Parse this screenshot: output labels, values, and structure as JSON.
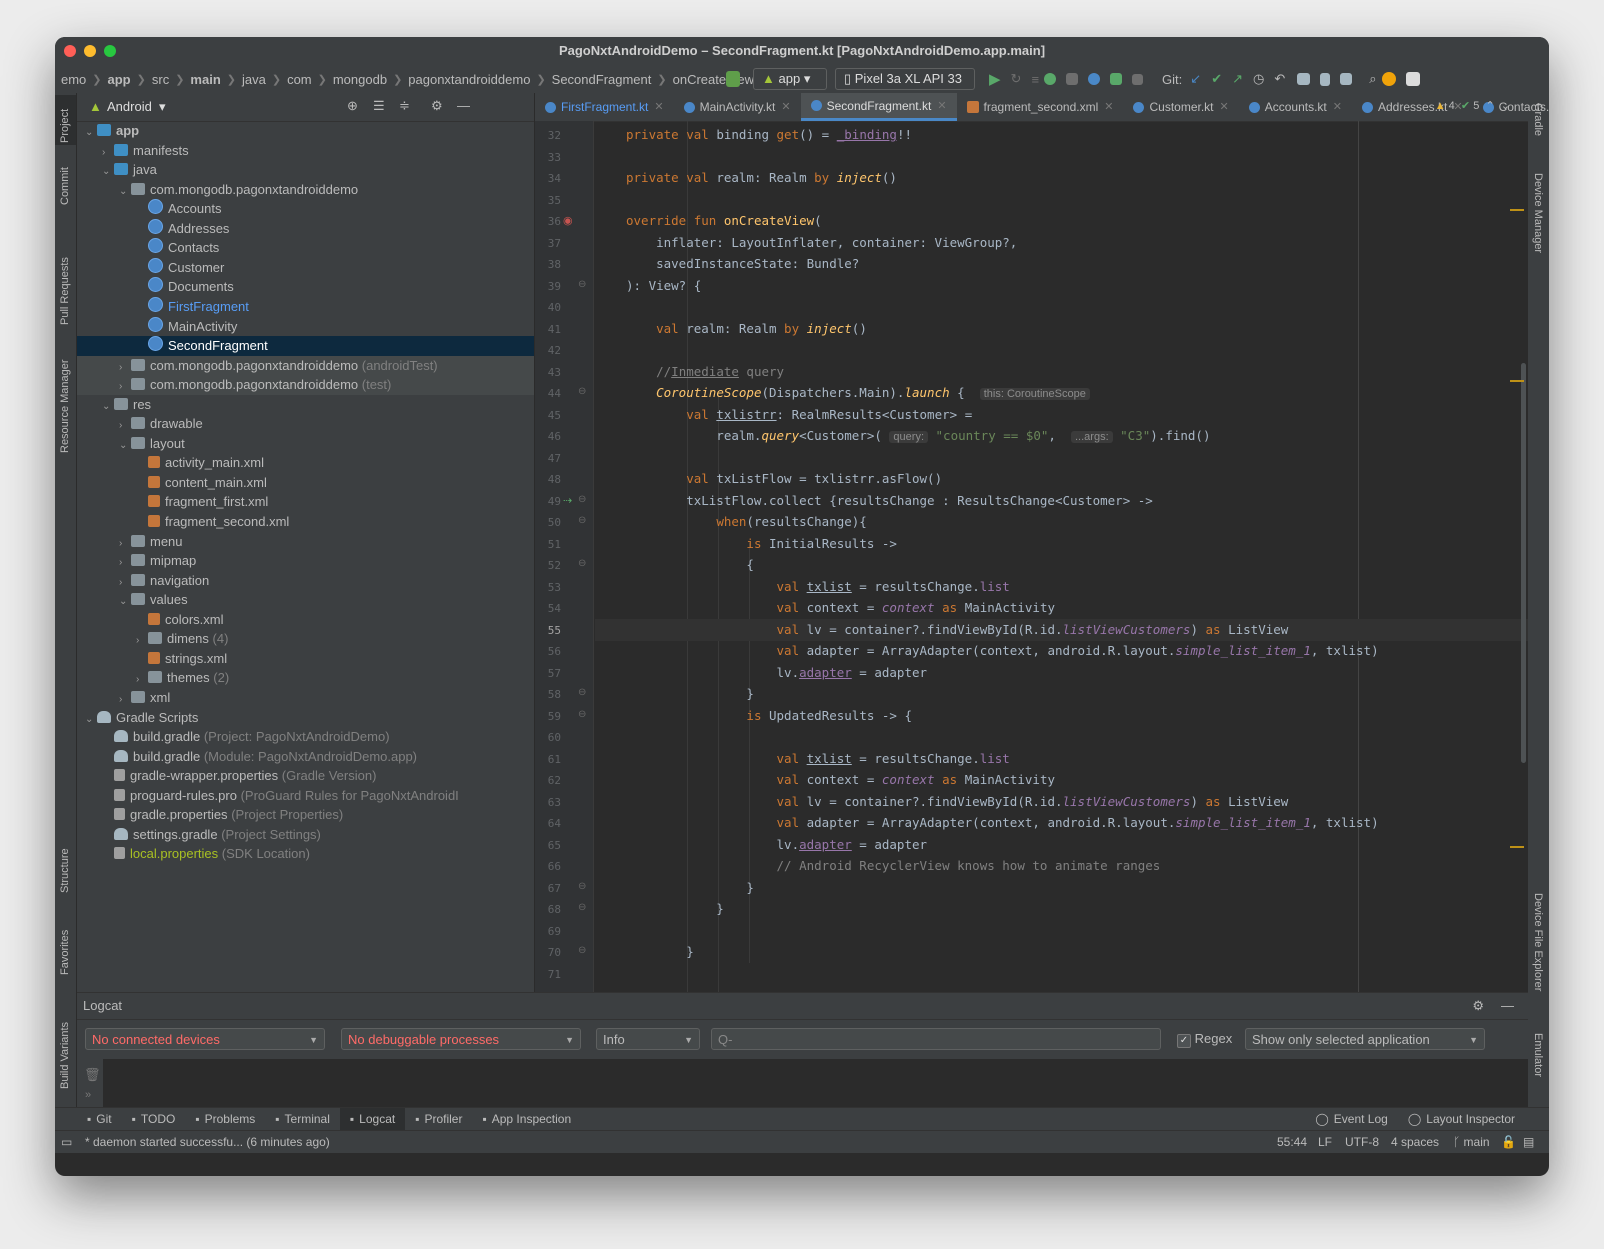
{
  "window": {
    "title": "PagoNxtAndroidDemo – SecondFragment.kt [PagoNxtAndroidDemo.app.main]"
  },
  "breadcrumbs": [
    "emo",
    "app",
    "src",
    "main",
    "java",
    "com",
    "mongodb",
    "pagonxtandroiddemo",
    "SecondFragment",
    "onCreateView"
  ],
  "toolbar": {
    "config": "app",
    "device": "Pixel 3a XL API 33",
    "git_label": "Git:"
  },
  "left_tool_windows": [
    "Project",
    "Commit",
    "Pull Requests",
    "Resource Manager",
    "Structure",
    "Favorites",
    "Build Variants"
  ],
  "right_tool_windows": [
    "Gradle",
    "Device Manager",
    "Device File Explorer",
    "Emulator"
  ],
  "project_panel": {
    "view": "Android",
    "tree": [
      {
        "label": "app",
        "hint": "",
        "depth": 0,
        "chev": "v",
        "icon": "folder-blue",
        "bold": true
      },
      {
        "label": "manifests",
        "hint": "",
        "depth": 1,
        "chev": ">",
        "icon": "folder-blue"
      },
      {
        "label": "java",
        "hint": "",
        "depth": 1,
        "chev": "v",
        "icon": "folder-blue"
      },
      {
        "label": "com.mongodb.pagonxtandroiddemo",
        "hint": "",
        "depth": 2,
        "chev": "v",
        "icon": "package"
      },
      {
        "label": "Accounts",
        "hint": "",
        "depth": 3,
        "chev": "",
        "icon": "kotlin"
      },
      {
        "label": "Addresses",
        "hint": "",
        "depth": 3,
        "chev": "",
        "icon": "kotlin"
      },
      {
        "label": "Contacts",
        "hint": "",
        "depth": 3,
        "chev": "",
        "icon": "kotlin"
      },
      {
        "label": "Customer",
        "hint": "",
        "depth": 3,
        "chev": "",
        "icon": "kotlin"
      },
      {
        "label": "Documents",
        "hint": "",
        "depth": 3,
        "chev": "",
        "icon": "kotlin"
      },
      {
        "label": "FirstFragment",
        "hint": "",
        "depth": 3,
        "chev": "",
        "icon": "kotlin",
        "color": "#589df6"
      },
      {
        "label": "MainActivity",
        "hint": "",
        "depth": 3,
        "chev": "",
        "icon": "kotlin"
      },
      {
        "label": "SecondFragment",
        "hint": "",
        "depth": 3,
        "chev": "",
        "icon": "kotlin",
        "selected": true
      },
      {
        "label": "com.mongodb.pagonxtandroiddemo",
        "hint": "(androidTest)",
        "depth": 2,
        "chev": ">",
        "icon": "package",
        "highlight": true
      },
      {
        "label": "com.mongodb.pagonxtandroiddemo",
        "hint": "(test)",
        "depth": 2,
        "chev": ">",
        "icon": "package",
        "highlight": true
      },
      {
        "label": "res",
        "hint": "",
        "depth": 1,
        "chev": "v",
        "icon": "folder"
      },
      {
        "label": "drawable",
        "hint": "",
        "depth": 2,
        "chev": ">",
        "icon": "folder"
      },
      {
        "label": "layout",
        "hint": "",
        "depth": 2,
        "chev": "v",
        "icon": "folder"
      },
      {
        "label": "activity_main.xml",
        "hint": "",
        "depth": 3,
        "chev": "",
        "icon": "xml"
      },
      {
        "label": "content_main.xml",
        "hint": "",
        "depth": 3,
        "chev": "",
        "icon": "xml"
      },
      {
        "label": "fragment_first.xml",
        "hint": "",
        "depth": 3,
        "chev": "",
        "icon": "xml"
      },
      {
        "label": "fragment_second.xml",
        "hint": "",
        "depth": 3,
        "chev": "",
        "icon": "xml"
      },
      {
        "label": "menu",
        "hint": "",
        "depth": 2,
        "chev": ">",
        "icon": "folder"
      },
      {
        "label": "mipmap",
        "hint": "",
        "depth": 2,
        "chev": ">",
        "icon": "folder"
      },
      {
        "label": "navigation",
        "hint": "",
        "depth": 2,
        "chev": ">",
        "icon": "folder"
      },
      {
        "label": "values",
        "hint": "",
        "depth": 2,
        "chev": "v",
        "icon": "folder"
      },
      {
        "label": "colors.xml",
        "hint": "",
        "depth": 3,
        "chev": "",
        "icon": "xml"
      },
      {
        "label": "dimens",
        "hint": "(4)",
        "depth": 3,
        "chev": ">",
        "icon": "folder"
      },
      {
        "label": "strings.xml",
        "hint": "",
        "depth": 3,
        "chev": "",
        "icon": "xml"
      },
      {
        "label": "themes",
        "hint": "(2)",
        "depth": 3,
        "chev": ">",
        "icon": "folder"
      },
      {
        "label": "xml",
        "hint": "",
        "depth": 2,
        "chev": ">",
        "icon": "folder"
      },
      {
        "label": "Gradle Scripts",
        "hint": "",
        "depth": 0,
        "chev": "v",
        "icon": "gradle"
      },
      {
        "label": "build.gradle",
        "hint": "(Project: PagoNxtAndroidDemo)",
        "depth": 1,
        "chev": "",
        "icon": "gradle"
      },
      {
        "label": "build.gradle",
        "hint": "(Module: PagoNxtAndroidDemo.app)",
        "depth": 1,
        "chev": "",
        "icon": "gradle"
      },
      {
        "label": "gradle-wrapper.properties",
        "hint": "(Gradle Version)",
        "depth": 1,
        "chev": "",
        "icon": "prop"
      },
      {
        "label": "proguard-rules.pro",
        "hint": "(ProGuard Rules for PagoNxtAndroidI",
        "depth": 1,
        "chev": "",
        "icon": "prop"
      },
      {
        "label": "gradle.properties",
        "hint": "(Project Properties)",
        "depth": 1,
        "chev": "",
        "icon": "prop"
      },
      {
        "label": "settings.gradle",
        "hint": "(Project Settings)",
        "depth": 1,
        "chev": "",
        "icon": "gradle"
      },
      {
        "label": "local.properties",
        "hint": "(SDK Location)",
        "depth": 1,
        "chev": "",
        "icon": "prop",
        "color": "#a8c023"
      }
    ]
  },
  "editor_tabs": [
    {
      "label": "FirstFragment.kt",
      "active": false,
      "color": "#589df6"
    },
    {
      "label": "MainActivity.kt",
      "active": false
    },
    {
      "label": "SecondFragment.kt",
      "active": true
    },
    {
      "label": "fragment_second.xml",
      "active": false
    },
    {
      "label": "Customer.kt",
      "active": false
    },
    {
      "label": "Accounts.kt",
      "active": false
    },
    {
      "label": "Addresses.kt",
      "active": false
    },
    {
      "label": "Contacts.kt",
      "active": false
    }
  ],
  "inspections": {
    "warnings": "4",
    "weak_warnings": "5"
  },
  "code_lines": [
    {
      "n": "32",
      "html": "<span class=\"kw\">private val</span> binding <span class=\"kw\">get</span>() = <span class=\"pr und\">_binding</span>!!"
    },
    {
      "n": "33",
      "html": ""
    },
    {
      "n": "34",
      "html": "<span class=\"kw\">private val</span> realm: Realm <span class=\"kw\">by</span> <span class=\"ext\">inject</span>()"
    },
    {
      "n": "35",
      "html": ""
    },
    {
      "n": "36",
      "html": "<span class=\"kw\">override fun</span> <span class=\"fn\">onCreateView</span>("
    },
    {
      "n": "37",
      "html": "    inflater: LayoutInflater, container: ViewGroup?,"
    },
    {
      "n": "38",
      "html": "    savedInstanceState: Bundle?"
    },
    {
      "n": "39",
      "html": "): View? {"
    },
    {
      "n": "40",
      "html": ""
    },
    {
      "n": "41",
      "html": "    <span class=\"kw\">val</span> realm: Realm <span class=\"kw\">by</span> <span class=\"ext\">inject</span>()"
    },
    {
      "n": "42",
      "html": ""
    },
    {
      "n": "43",
      "html": "    <span class=\"cm\">//<span class=\"und\">Inmediate</span> query</span>"
    },
    {
      "n": "44",
      "html": "    <span class=\"ext\">CoroutineScope</span>(Dispatchers.Main).<span class=\"ext\">launch</span> {  <span class=\"inl\">this: CoroutineScope</span>"
    },
    {
      "n": "45",
      "html": "        <span class=\"kw\">val</span> <span class=\"und\">txlistrr</span>: RealmResults&lt;Customer&gt; ="
    },
    {
      "n": "46",
      "html": "            realm.<span class=\"ext\">query</span>&lt;Customer&gt;( <span class=\"inl\">query:</span> <span class=\"str\">\"country == $0\"</span>,  <span class=\"inl\">...args:</span> <span class=\"str\">\"C3\"</span>).find()"
    },
    {
      "n": "47",
      "html": ""
    },
    {
      "n": "48",
      "html": "        <span class=\"kw\">val</span> txListFlow = txlistrr.asFlow()"
    },
    {
      "n": "49",
      "html": "        txListFlow.collect {resultsChange : ResultsChange&lt;Customer&gt; -&gt;"
    },
    {
      "n": "50",
      "html": "            <span class=\"kw\">when</span>(resultsChange){"
    },
    {
      "n": "51",
      "html": "                <span class=\"kw\">is</span> InitialResults -&gt;"
    },
    {
      "n": "52",
      "html": "                {"
    },
    {
      "n": "53",
      "html": "                    <span class=\"kw\">val</span> <span class=\"und\">txlist</span> = resultsChange.<span class=\"pr\">list</span>"
    },
    {
      "n": "54",
      "html": "                    <span class=\"kw\">val</span> context = <span class=\"it\">context</span> <span class=\"kw\">as</span> MainActivity"
    },
    {
      "n": "55",
      "html": "                    <span class=\"kw\">val</span> lv = container?.findViewById(R.id.<span class=\"it\">listViewCustomers</span>) <span class=\"kw\">as</span> ListView",
      "cur": true
    },
    {
      "n": "56",
      "html": "                    <span class=\"kw\">val</span> adapter = ArrayAdapter(context, android.R.layout.<span class=\"it\">simple_list_item_1</span>, txlist)"
    },
    {
      "n": "57",
      "html": "                    lv.<span class=\"pr und\">adapter</span> = adapter"
    },
    {
      "n": "58",
      "html": "                }"
    },
    {
      "n": "59",
      "html": "                <span class=\"kw\">is</span> UpdatedResults -&gt; {"
    },
    {
      "n": "60",
      "html": ""
    },
    {
      "n": "61",
      "html": "                    <span class=\"kw\">val</span> <span class=\"und\">txlist</span> = resultsChange.<span class=\"pr\">list</span>"
    },
    {
      "n": "62",
      "html": "                    <span class=\"kw\">val</span> context = <span class=\"it\">context</span> <span class=\"kw\">as</span> MainActivity"
    },
    {
      "n": "63",
      "html": "                    <span class=\"kw\">val</span> lv = container?.findViewById(R.id.<span class=\"it\">listViewCustomers</span>) <span class=\"kw\">as</span> ListView"
    },
    {
      "n": "64",
      "html": "                    <span class=\"kw\">val</span> adapter = ArrayAdapter(context, android.R.layout.<span class=\"it\">simple_list_item_1</span>, txlist)"
    },
    {
      "n": "65",
      "html": "                    lv.<span class=\"pr und\">adapter</span> = adapter"
    },
    {
      "n": "66",
      "html": "                    <span class=\"cm\">// Android RecyclerView knows how to animate ranges</span>"
    },
    {
      "n": "67",
      "html": "                }"
    },
    {
      "n": "68",
      "html": "            }"
    },
    {
      "n": "69",
      "html": ""
    },
    {
      "n": "70",
      "html": "        }"
    },
    {
      "n": "71",
      "html": ""
    }
  ],
  "logcat": {
    "title": "Logcat",
    "device": "No connected devices",
    "process": "No debuggable processes",
    "level": "Info",
    "search_placeholder": "Q-",
    "regex_label": "Regex",
    "filter": "Show only selected application"
  },
  "bottom_tabs": [
    "Git",
    "TODO",
    "Problems",
    "Terminal",
    "Logcat",
    "Profiler",
    "App Inspection"
  ],
  "bottom_right": [
    "Event Log",
    "Layout Inspector"
  ],
  "status": {
    "message": "* daemon started successfu... (6 minutes ago)",
    "position": "55:44",
    "line_sep": "LF",
    "encoding": "UTF-8",
    "indent": "4 spaces",
    "branch": "main"
  },
  "colors": {
    "accent": "#4a88c7",
    "selection": "#0d293e",
    "error_text": "#ff6b68"
  }
}
